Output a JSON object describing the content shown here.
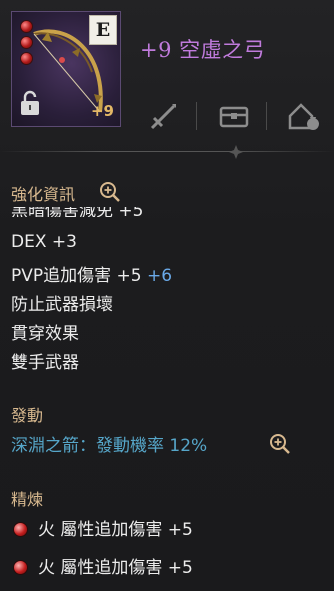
{
  "item": {
    "name": "+9 空虛之弓",
    "grade": "E",
    "enhance_level": "+9",
    "name_color": "#c07bdc"
  },
  "toolbar": {
    "icons": [
      "sword-icon",
      "treasure-chest-icon",
      "house-bag-icon"
    ]
  },
  "enhance_section": {
    "title": "強化資訊",
    "cut_line": "黑暗傷害減免 +5",
    "lines": [
      {
        "text": "DEX +3",
        "bonus": ""
      },
      {
        "text": "PVP追加傷害 +5",
        "bonus": "+6"
      },
      {
        "text": "防止武器損壞",
        "bonus": ""
      },
      {
        "text": "貫穿效果",
        "bonus": ""
      },
      {
        "text": "雙手武器",
        "bonus": ""
      }
    ]
  },
  "activation_section": {
    "title": "發動",
    "skill": "深淵之箭：發動機率 12%"
  },
  "refine_section": {
    "title": "精煉",
    "lines": [
      {
        "text": "火 屬性追加傷害 +5"
      },
      {
        "text": "火 屬性追加傷害 +5"
      }
    ]
  },
  "colors": {
    "section_title": "#d8b98f",
    "bonus_value": "#6aa9e8",
    "skill_text": "#56a6c9",
    "enhance_level": "#e3b866"
  }
}
